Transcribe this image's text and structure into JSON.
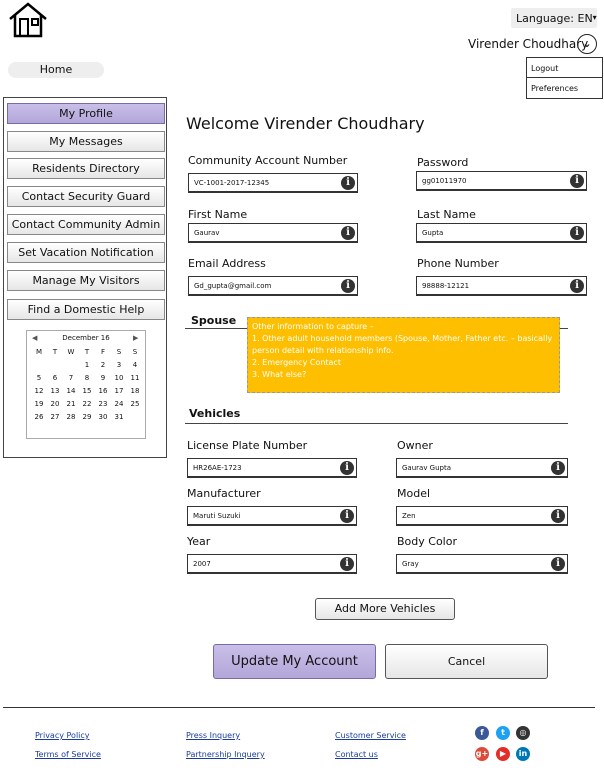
{
  "header": {
    "language_label": "Language: EN",
    "user_name": "Virender Choudhary",
    "menu": [
      "Logout",
      "Preferences"
    ],
    "home_label": "Home"
  },
  "sidebar": {
    "items": [
      {
        "label": "My Profile",
        "active": true
      },
      {
        "label": "My Messages"
      },
      {
        "label": "Residents Directory"
      },
      {
        "label": "Contact Security Guard"
      },
      {
        "label": "Contact Community Admin"
      },
      {
        "label": "Set Vacation Notification"
      },
      {
        "label": "Manage My Visitors"
      },
      {
        "label": "Find a Domestic Help"
      }
    ],
    "calendar": {
      "month": "December 16",
      "weekdays": [
        "M",
        "T",
        "W",
        "T",
        "F",
        "S",
        "S"
      ],
      "days": [
        "",
        "",
        "",
        "1",
        "2",
        "3",
        "4",
        "5",
        "6",
        "7",
        "8",
        "9",
        "10",
        "11",
        "12",
        "13",
        "14",
        "15",
        "16",
        "17",
        "18",
        "19",
        "20",
        "21",
        "22",
        "23",
        "24",
        "25",
        "26",
        "27",
        "28",
        "29",
        "30",
        "31",
        ""
      ]
    }
  },
  "main": {
    "welcome": "Welcome Virender Choudhary",
    "fields": {
      "community_account_number": {
        "label": "Community Account Number",
        "value": "VC-1001-2017-12345"
      },
      "password": {
        "label": "Password",
        "value": "gg01011970"
      },
      "first_name": {
        "label": "First Name",
        "value": "Gaurav"
      },
      "last_name": {
        "label": "Last Name",
        "value": "Gupta"
      },
      "email": {
        "label": "Email Address",
        "value": "Gd_gupta@gmail.com"
      },
      "phone": {
        "label": "Phone Number",
        "value": "98888-12121"
      }
    },
    "spouse_heading": "Spouse",
    "note": "Other information to capture –\n1. Other adult household members (Spouse, Mother, Father etc. – basically person detail with relationship info.\n2. Emergency Contact\n3. What else?",
    "vehicles_heading": "Vehicles",
    "vehicle": {
      "license_plate": {
        "label": "License Plate Number",
        "value": "HR26AE-1723"
      },
      "owner": {
        "label": "Owner",
        "value": "Gaurav Gupta"
      },
      "manufacturer": {
        "label": "Manufacturer",
        "value": "Maruti Suzuki"
      },
      "model": {
        "label": "Model",
        "value": "Zen"
      },
      "year": {
        "label": "Year",
        "value": "2007"
      },
      "body_color": {
        "label": "Body Color",
        "value": "Gray"
      }
    },
    "add_vehicles_label": "Add More Vehicles",
    "update_label": "Update My Account",
    "cancel_label": "Cancel"
  },
  "footer": {
    "links": [
      "Privacy Policy",
      "Terms of Service",
      "Press Inquery",
      "Partnership Inquery",
      "Customer Service",
      "Contact us"
    ],
    "social": [
      {
        "icon": "facebook-icon",
        "glyph": "f",
        "color": "#3b5998"
      },
      {
        "icon": "twitter-icon",
        "glyph": "t",
        "color": "#1da1f2"
      },
      {
        "icon": "instagram-icon",
        "glyph": "◎",
        "color": "#333333"
      },
      {
        "icon": "google-plus-icon",
        "glyph": "g+",
        "color": "#dd4b39"
      },
      {
        "icon": "youtube-icon",
        "glyph": "▶",
        "color": "#e52d27"
      },
      {
        "icon": "linkedin-icon",
        "glyph": "in",
        "color": "#0077b5"
      }
    ]
  }
}
